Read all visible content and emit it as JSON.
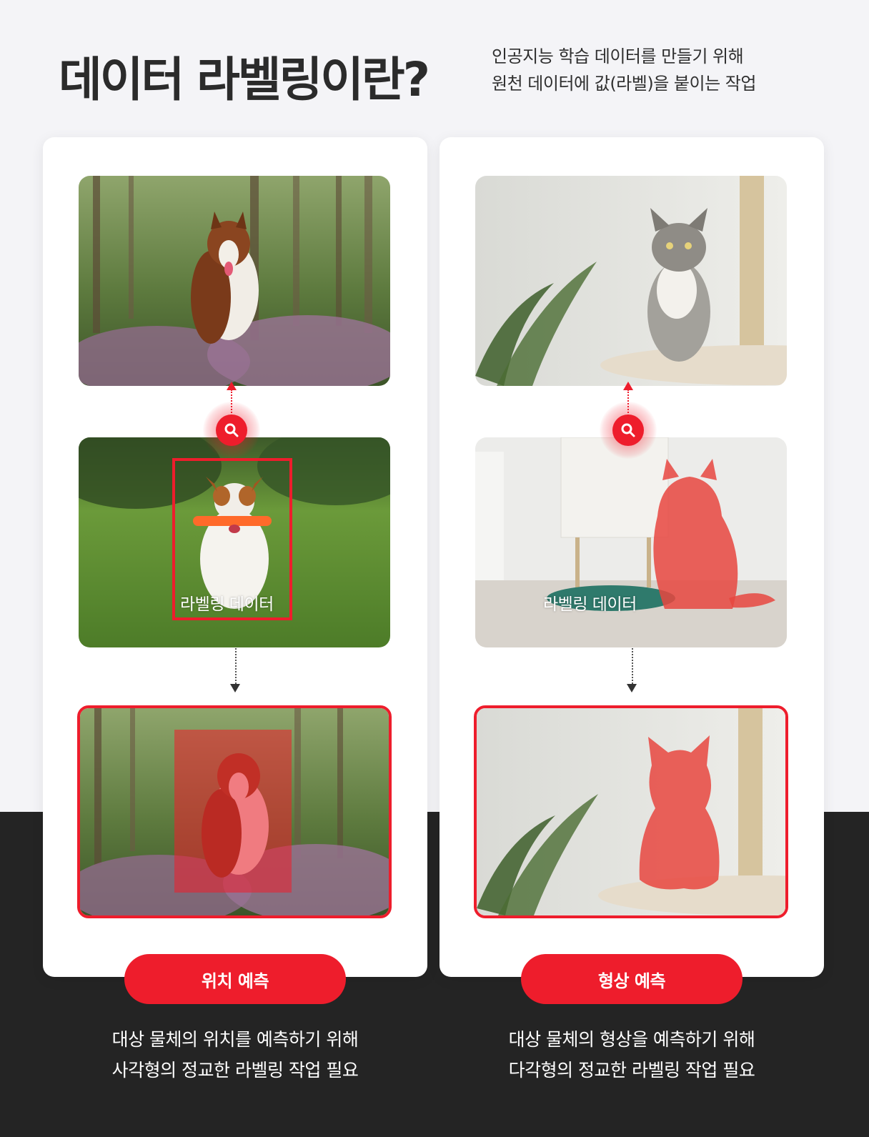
{
  "header": {
    "title": "데이터 라벨링이란?",
    "subtitle_line1": "인공지능 학습 데이터를 만들기 위해",
    "subtitle_line2": "원천 데이터에 값(라벨)을 붙이는 작업"
  },
  "panels": [
    {
      "overlay_label": "라벨링 데이터",
      "tag": "위치 예측",
      "desc_line1": "대상 물체의 위치를 예측하기 위해",
      "desc_line2": "사각형의 정교한 라벨링 작업 필요"
    },
    {
      "overlay_label": "라벨링 데이터",
      "tag": "형상 예측",
      "desc_line1": "대상 물체의 형상을 예측하기 위해",
      "desc_line2": "다각형의 정교한 라벨링 작업 필요"
    }
  ],
  "icons": {
    "search": "search-icon",
    "arrow": "arrow-icon"
  },
  "colors": {
    "accent": "#ee1d2c",
    "dark_band": "#242424",
    "background": "#f4f4f7"
  }
}
